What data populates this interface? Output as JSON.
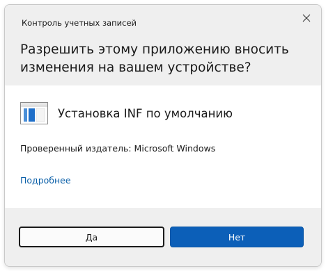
{
  "dialog": {
    "window_title": "Контроль учетных записей",
    "question": "Разрешить этому приложению вносить изменения на вашем устройстве?",
    "close_icon": "close-icon",
    "app": {
      "icon": "application-window-icon",
      "name": "Установка INF по умолчанию"
    },
    "publisher": "Проверенный издатель: Microsoft Windows",
    "more_link": "Подробнее",
    "buttons": {
      "yes": "Да",
      "no": "Нет"
    },
    "colors": {
      "header_bg": "#efefef",
      "accent": "#0c5fb8",
      "link": "#0a5fa8"
    }
  }
}
